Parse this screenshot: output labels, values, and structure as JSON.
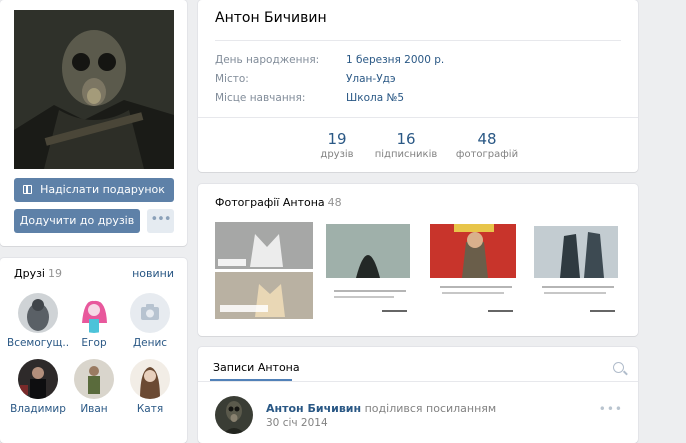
{
  "profile": {
    "name": "Антон Бичивин",
    "info": [
      {
        "label": "День народження:",
        "value": "1 березня 2000 р."
      },
      {
        "label": "Місто:",
        "value": "Улан-Удэ"
      },
      {
        "label": "Місце навчання:",
        "value": "Школа №5"
      }
    ],
    "counters": [
      {
        "num": "19",
        "label": "друзів"
      },
      {
        "num": "16",
        "label": "підписників"
      },
      {
        "num": "48",
        "label": "фотографій"
      }
    ]
  },
  "actions": {
    "gift": "Надіслати подарунок",
    "add_friend": "Додучити до друзів",
    "more": "•••"
  },
  "friends": {
    "title": "Друзі",
    "count": "19",
    "new_label": "новини",
    "items": [
      {
        "name": "Всемогущ..."
      },
      {
        "name": "Егор"
      },
      {
        "name": "Денис"
      },
      {
        "name": "Владимир"
      },
      {
        "name": "Иван"
      },
      {
        "name": "Катя"
      }
    ]
  },
  "photos": {
    "title": "Фотографії Антона",
    "count": "48"
  },
  "wall": {
    "tab": "Записи Антона",
    "post": {
      "author": "Антон Бичивин",
      "action": "поділився посиланням",
      "date": "30 січ 2014"
    }
  }
}
